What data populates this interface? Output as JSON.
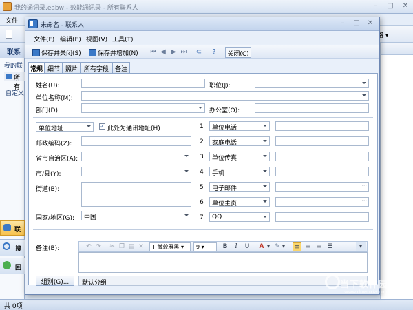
{
  "main": {
    "title": "我的通讯录.eabw - 效能通讯录 - 所有联系人",
    "menu_file": "文件",
    "toolbar_right": "格 ▾",
    "left_header": "联系",
    "left_mine": "我的联",
    "left_all": "所有",
    "left_custom": "自定义",
    "nav_contacts": "联",
    "nav_search": "搜",
    "nav_recycle": "回",
    "status": "共 0项",
    "watermark": "当下软件园",
    "watermark_url": "www.downxia.com"
  },
  "dialog": {
    "title": "未命名 - 联系人",
    "menu": [
      "文件(F)",
      "编辑(E)",
      "视图(V)",
      "工具(T)"
    ],
    "toolbar": {
      "save_close": "保存并关闭(S)",
      "save_add": "保存并增加(N)",
      "close": "关闭(C)"
    },
    "tabs": [
      "常规",
      "细节",
      "照片",
      "所有字段",
      "备注"
    ],
    "fields": {
      "name_label": "姓名(U):",
      "name_value": "",
      "position_label": "职位(J):",
      "company_label": "单位名称(M):",
      "dept_label": "部门(D):",
      "office_label": "办公室(O):",
      "address_type": "单位地址",
      "mailing_check_label": "此处为通讯地址(H)",
      "mailing_checked": true,
      "postcode_label": "邮政编码(Z):",
      "province_label": "省市自治区(A):",
      "city_label": "市/县(Y):",
      "street_label": "街道(B):",
      "country_label": "国家/地区(G):",
      "country_value": "中国",
      "notes_label": "备注(B):",
      "group_button": "组别(G)...",
      "group_value": "默认分组"
    },
    "phones": [
      {
        "num": "1",
        "type": "单位电话"
      },
      {
        "num": "2",
        "type": "家庭电话"
      },
      {
        "num": "3",
        "type": "单位传真"
      },
      {
        "num": "4",
        "type": "手机"
      },
      {
        "num": "5",
        "type": "电子邮件"
      },
      {
        "num": "6",
        "type": "单位主页"
      },
      {
        "num": "7",
        "type": "QQ"
      }
    ],
    "format": {
      "font": "微软雅黑",
      "size": "9",
      "bold": "B",
      "italic": "I",
      "underline": "U",
      "font_color": "A"
    }
  }
}
